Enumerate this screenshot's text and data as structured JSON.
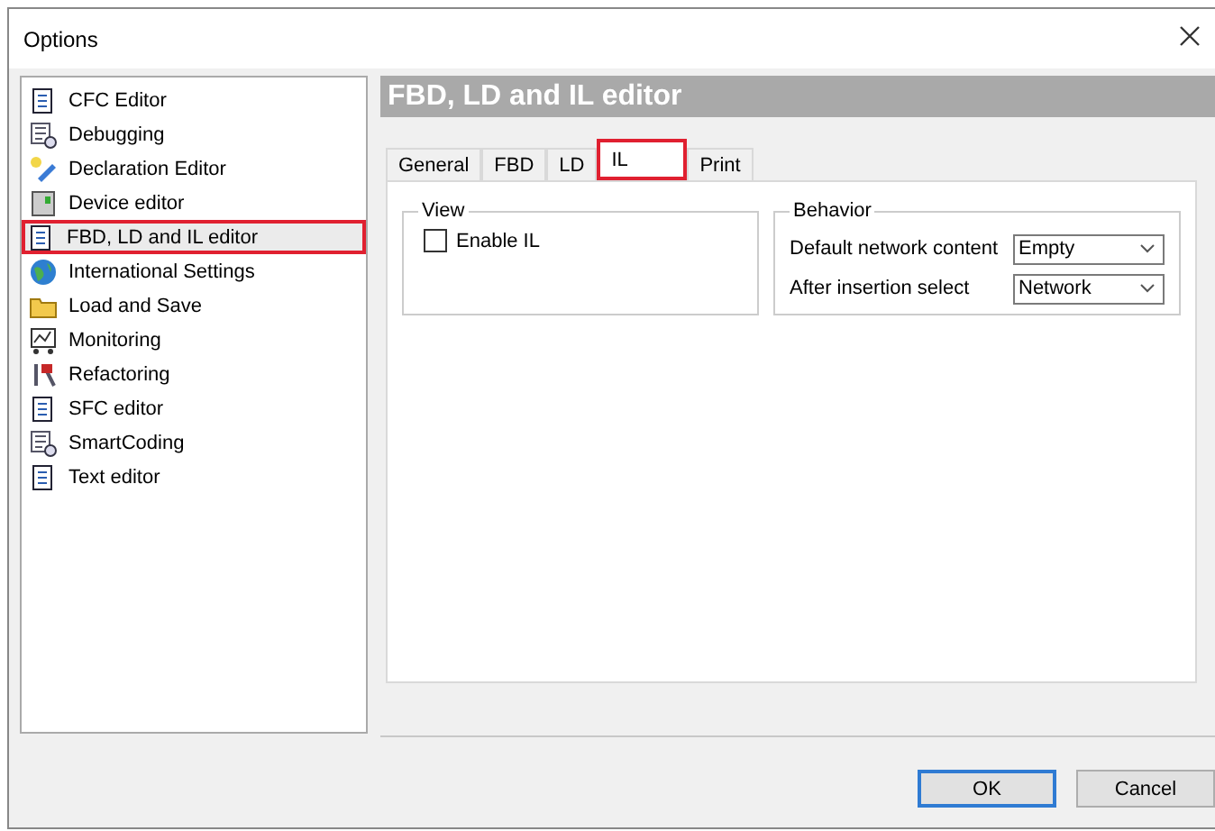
{
  "window": {
    "title": "Options"
  },
  "sidebar": {
    "items": [
      {
        "label": "CFC Editor",
        "kind": "document",
        "selected": false,
        "annotated": false
      },
      {
        "label": "Debugging",
        "kind": "list",
        "selected": false,
        "annotated": false
      },
      {
        "label": "Declaration Editor",
        "kind": "pencil",
        "selected": false,
        "annotated": false
      },
      {
        "label": "Device editor",
        "kind": "device",
        "selected": false,
        "annotated": false
      },
      {
        "label": "FBD, LD and IL editor",
        "kind": "document",
        "selected": true,
        "annotated": true
      },
      {
        "label": "International Settings",
        "kind": "globe",
        "selected": false,
        "annotated": false
      },
      {
        "label": "Load and Save",
        "kind": "folder",
        "selected": false,
        "annotated": false
      },
      {
        "label": "Monitoring",
        "kind": "monitor",
        "selected": false,
        "annotated": false
      },
      {
        "label": "Refactoring",
        "kind": "tools",
        "selected": false,
        "annotated": false
      },
      {
        "label": "SFC editor",
        "kind": "document",
        "selected": false,
        "annotated": false
      },
      {
        "label": "SmartCoding",
        "kind": "list",
        "selected": false,
        "annotated": false
      },
      {
        "label": "Text editor",
        "kind": "document",
        "selected": false,
        "annotated": false
      }
    ]
  },
  "page": {
    "title": "FBD, LD and IL editor",
    "tabs": [
      {
        "label": "General",
        "selected": false,
        "annotated": false
      },
      {
        "label": "FBD",
        "selected": false,
        "annotated": false
      },
      {
        "label": "LD",
        "selected": false,
        "annotated": false
      },
      {
        "label": "IL",
        "selected": true,
        "annotated": true
      },
      {
        "label": "Print",
        "selected": false,
        "annotated": false
      }
    ],
    "view": {
      "title": "View",
      "checkbox": {
        "label": "Enable IL",
        "checked": false
      }
    },
    "behavior": {
      "title": "Behavior",
      "fields": [
        {
          "label": "Default network content",
          "value": "Empty"
        },
        {
          "label": "After insertion select",
          "value": "Network"
        }
      ]
    }
  },
  "buttons": [
    {
      "label": "OK",
      "default": true
    },
    {
      "label": "Cancel",
      "default": false
    }
  ]
}
